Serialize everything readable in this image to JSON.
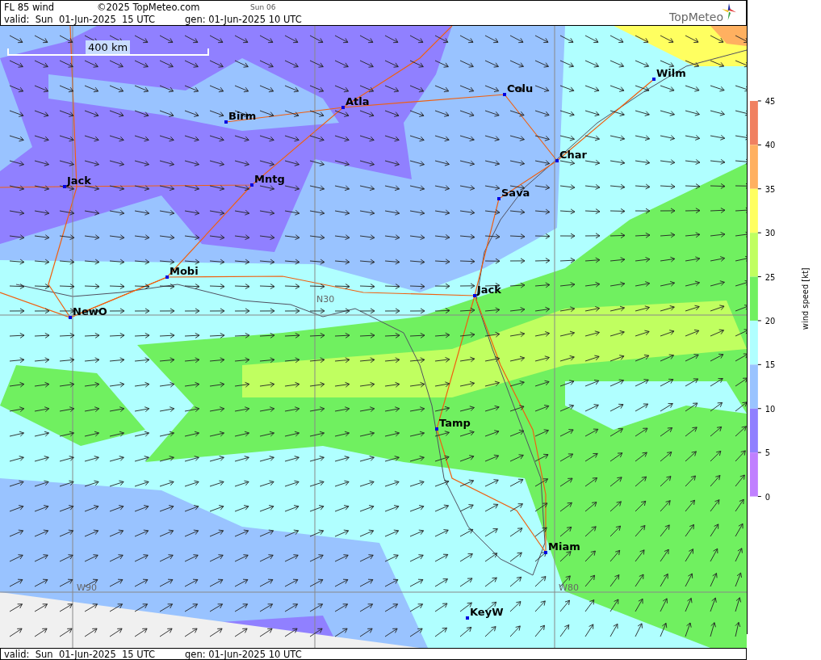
{
  "header": {
    "title": "FL 85 wind",
    "copyright": "©2025 TopMeteo.com",
    "day_tab": "Sun 06",
    "valid": "valid:  Sun  01-Jun-2025  15 UTC",
    "generated": "gen: 01-Jun-2025 10 UTC"
  },
  "logo": {
    "text": "TopMeteo"
  },
  "map": {
    "scale_label": "400 km",
    "grid_labels": [
      "N30",
      "W90",
      "W80"
    ],
    "cities": [
      {
        "name": "Wilm"
      },
      {
        "name": "Colu"
      },
      {
        "name": "Atla"
      },
      {
        "name": "Birm"
      },
      {
        "name": "Char"
      },
      {
        "name": "Jack"
      },
      {
        "name": "Mntg"
      },
      {
        "name": "Sava"
      },
      {
        "name": "Mobi"
      },
      {
        "name": "Jack"
      },
      {
        "name": "NewO"
      },
      {
        "name": "Tamp"
      },
      {
        "name": "Miam"
      },
      {
        "name": "KeyW"
      }
    ]
  },
  "legend": {
    "title": "wind speed [kt]",
    "ticks": [
      "45",
      "40",
      "35",
      "30",
      "25",
      "20",
      "15",
      "10",
      "5",
      "0"
    ],
    "bands": [
      {
        "color": "#f08060"
      },
      {
        "color": "#ffb060"
      },
      {
        "color": "#ffff60"
      },
      {
        "color": "#c0ff60"
      },
      {
        "color": "#70f060"
      },
      {
        "color": "#b0ffff"
      },
      {
        "color": "#99c3ff"
      },
      {
        "color": "#9080ff"
      },
      {
        "color": "#c080ff"
      }
    ]
  },
  "footer": {
    "valid": "valid:  Sun  01-Jun-2025  15 UTC",
    "generated": "gen: 01-Jun-2025 10 UTC"
  }
}
